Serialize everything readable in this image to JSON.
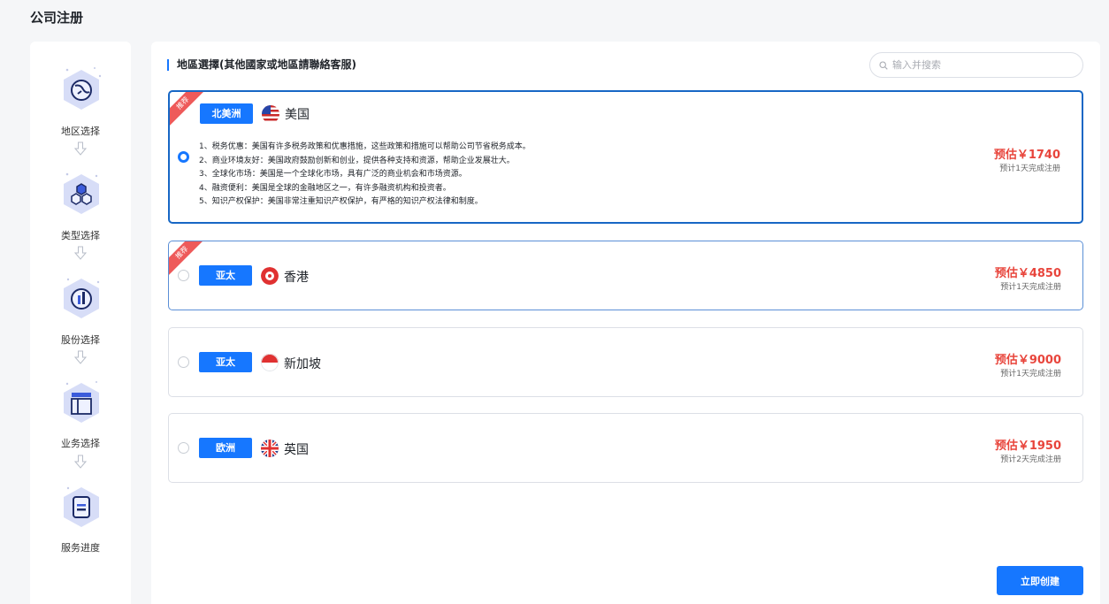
{
  "page": {
    "title": "公司注册"
  },
  "steps": [
    {
      "label": "地区选择",
      "icon": "globe-icon"
    },
    {
      "label": "类型选择",
      "icon": "hexagons-icon"
    },
    {
      "label": "股份选择",
      "icon": "pie-chart-icon"
    },
    {
      "label": "业务选择",
      "icon": "layout-icon"
    },
    {
      "label": "服务进度",
      "icon": "document-icon"
    }
  ],
  "main": {
    "section_title": "地區選擇(其他國家或地區請聯絡客服)",
    "search_placeholder": "输入并搜索",
    "create_button": "立即创建"
  },
  "regions": [
    {
      "tag": "北美洲",
      "country": "美国",
      "flag": "us-flag-icon",
      "price": "预估￥1740",
      "eta": "预计1天完成注册",
      "recommended": true,
      "selected": true,
      "details": [
        "1、税务优惠：美国有许多税务政策和优惠措施，这些政策和措施可以帮助公司节省税务成本。",
        "2、商业环境友好：美国政府鼓励创新和创业，提供各种支持和资源，帮助企业发展壮大。",
        "3、全球化市场：美国是一个全球化市场，具有广泛的商业机会和市场资源。",
        "4、融资便利：美国是全球的金融地区之一，有许多融资机构和投资者。",
        "5、知识产权保护：美国非常注重知识产权保护，有严格的知识产权法律和制度。"
      ]
    },
    {
      "tag": "亚太",
      "country": "香港",
      "flag": "hk-flag-icon",
      "price": "预估￥4850",
      "eta": "预计1天完成注册",
      "recommended": true,
      "selected": false
    },
    {
      "tag": "亚太",
      "country": "新加坡",
      "flag": "sg-flag-icon",
      "price": "预估￥9000",
      "eta": "预计1天完成注册",
      "recommended": false,
      "selected": false
    },
    {
      "tag": "欧洲",
      "country": "英国",
      "flag": "uk-flag-icon",
      "price": "预估￥1950",
      "eta": "预计2天完成注册",
      "recommended": false,
      "selected": false
    }
  ],
  "badge": {
    "recommended_label": "推荐"
  },
  "colors": {
    "accent": "#1677ff",
    "price": "#e8453c",
    "ribbon": "#ee5a5a"
  }
}
